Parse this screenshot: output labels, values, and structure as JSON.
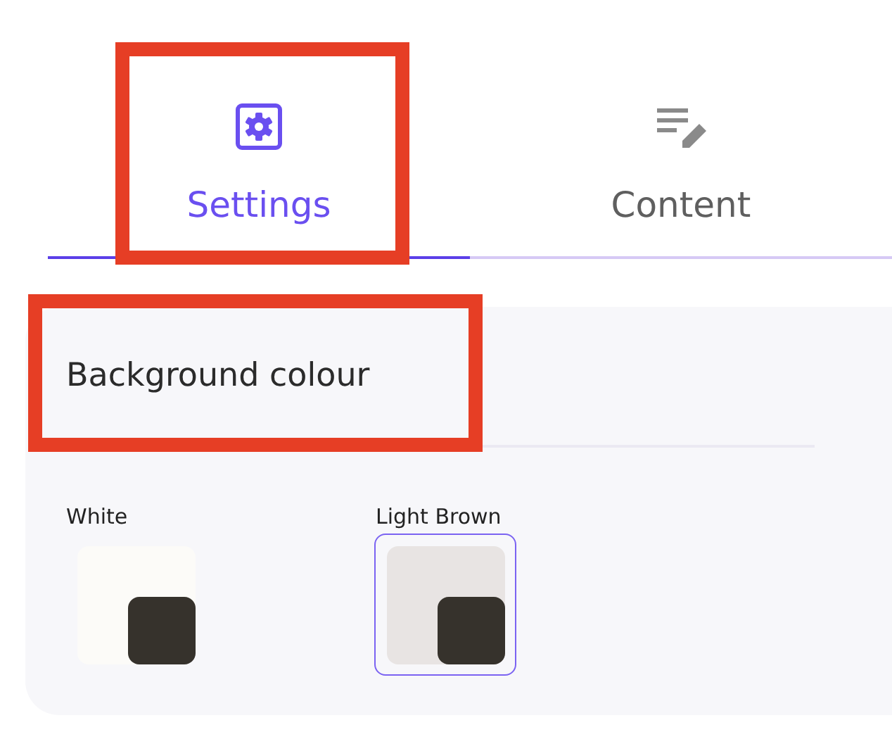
{
  "tabs": [
    {
      "label": "Settings",
      "kind": "settings",
      "selected": true
    },
    {
      "label": "Content",
      "kind": "content",
      "selected": false
    }
  ],
  "panel": {
    "title": "Background colour",
    "options": [
      {
        "label": "White",
        "color": "#fcfbf8",
        "selected": false
      },
      {
        "label": "Light Brown",
        "color": "#e8e4e3",
        "selected": true
      }
    ]
  }
}
